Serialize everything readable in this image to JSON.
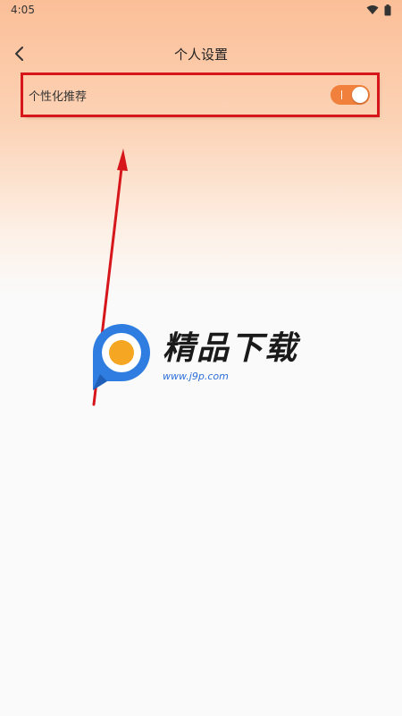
{
  "status_bar": {
    "time": "4:05",
    "icons": [
      "wifi-icon",
      "battery-icon"
    ]
  },
  "header": {
    "title": "个人设置",
    "back_icon": "chevron-left-icon"
  },
  "settings": [
    {
      "label": "个性化推荐",
      "enabled": true
    }
  ],
  "watermark": {
    "logo": "j9p-logo",
    "title": "精品下载",
    "url": "www.j9p.com"
  },
  "colors": {
    "accent": "#f0803c",
    "highlight_box": "#d6161b",
    "header_gradient_top": "#fbbf98",
    "background": "#fafafa",
    "logo_blue": "#2f7de1",
    "logo_orange": "#f5a623"
  }
}
